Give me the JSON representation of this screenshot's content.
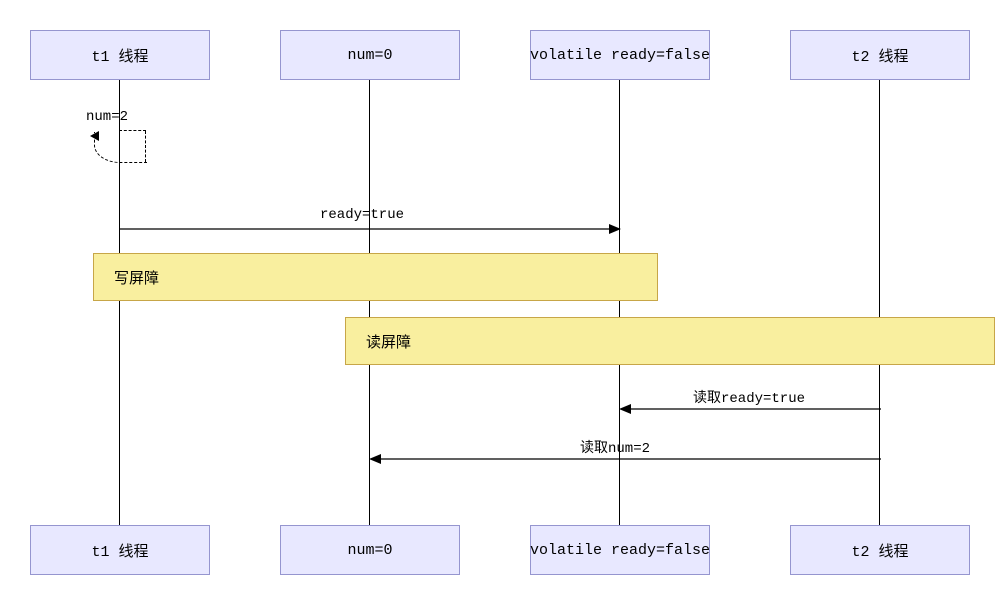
{
  "participants": {
    "p1": "t1 线程",
    "p2": "num=0",
    "p3": "volatile ready=false",
    "p4": "t2 线程"
  },
  "messages": {
    "self_msg": "num=2",
    "msg_ready_true": "ready=true",
    "write_barrier": "写屏障",
    "read_barrier": "读屏障",
    "msg_read_ready": "读取ready=true",
    "msg_read_num": "读取num=2"
  },
  "chart_data": {
    "type": "sequence-diagram",
    "participants": [
      {
        "id": "t1",
        "label": "t1 线程"
      },
      {
        "id": "num",
        "label": "num=0"
      },
      {
        "id": "ready",
        "label": "volatile ready=false"
      },
      {
        "id": "t2",
        "label": "t2 线程"
      }
    ],
    "events": [
      {
        "type": "self",
        "actor": "t1",
        "label": "num=2"
      },
      {
        "type": "message",
        "from": "t1",
        "to": "ready",
        "label": "ready=true"
      },
      {
        "type": "barrier",
        "span_from": "t1",
        "span_to": "ready",
        "label": "写屏障"
      },
      {
        "type": "barrier",
        "span_from": "num",
        "span_to": "t2",
        "label": "读屏障"
      },
      {
        "type": "message",
        "from": "t2",
        "to": "ready",
        "label": "读取ready=true"
      },
      {
        "type": "message",
        "from": "t2",
        "to": "num",
        "label": "读取num=2"
      }
    ],
    "notes": "UML sequence diagram showing volatile write/read barrier (写屏障 / 读屏障) ordering between two threads t1 and t2 over variables num and ready."
  }
}
